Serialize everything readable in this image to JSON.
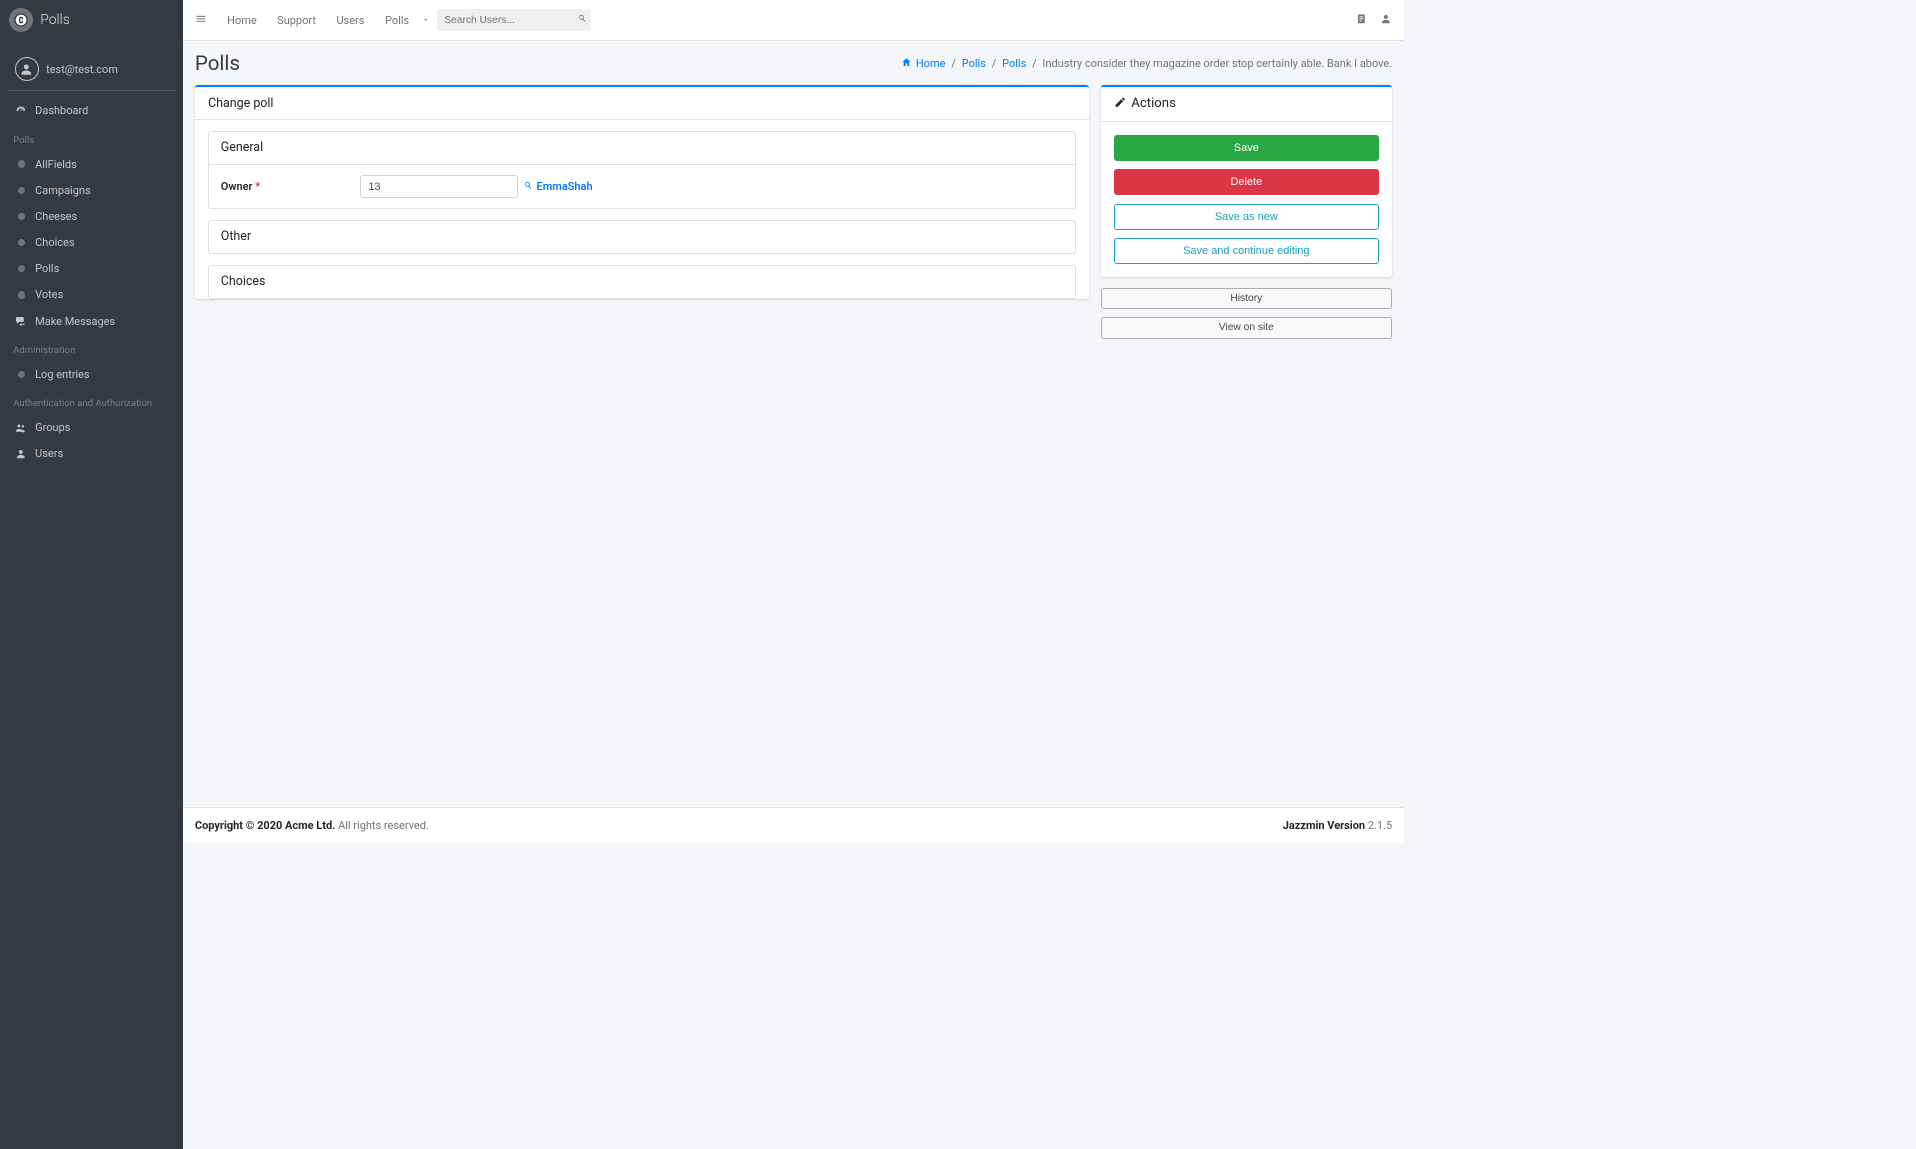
{
  "brand": {
    "title": "Polls"
  },
  "user": {
    "email": "test@test.com"
  },
  "sidebar": {
    "dashboard": "Dashboard",
    "sections": [
      {
        "header": "Polls",
        "items": [
          "AllFields",
          "Campaigns",
          "Cheeses",
          "Choices",
          "Polls",
          "Votes",
          "Make Messages"
        ]
      },
      {
        "header": "Administration",
        "items": [
          "Log entries"
        ]
      },
      {
        "header": "Authentication and Authorization",
        "items": [
          "Groups",
          "Users"
        ]
      }
    ]
  },
  "topnav": {
    "links": [
      "Home",
      "Support",
      "Users",
      "Polls"
    ],
    "search_placeholder": "Search Users..."
  },
  "page": {
    "title": "Polls",
    "breadcrumb": {
      "home": "Home",
      "app": "Polls",
      "model": "Polls",
      "current": "Industry consider they magazine order stop certainly able. Bank I above."
    }
  },
  "form": {
    "card_title": "Change poll",
    "sections": {
      "general": {
        "title": "General",
        "owner_label": "Owner",
        "owner_value": "13",
        "owner_link_text": "EmmaShah"
      },
      "other": {
        "title": "Other"
      },
      "choices": {
        "title": "Choices"
      }
    }
  },
  "actions": {
    "title": "Actions",
    "save": "Save",
    "delete": "Delete",
    "save_as_new": "Save as new",
    "save_continue": "Save and continue editing",
    "history": "History",
    "view_on_site": "View on site"
  },
  "footer": {
    "copyright_strong": "Copyright © 2020 Acme Ltd.",
    "copyright_rest": " All rights reserved.",
    "jazzmin_label": "Jazzmin Version",
    "jazzmin_version": " 2.1.5"
  }
}
